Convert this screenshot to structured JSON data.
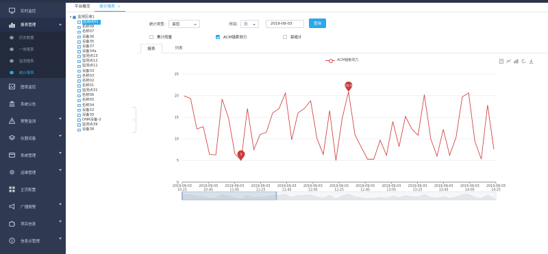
{
  "sidebar": {
    "items": [
      {
        "label": "实时监控",
        "icon": "monitor-icon",
        "arrow": false
      },
      {
        "label": "报表管理",
        "icon": "chart-bar-icon",
        "arrow": "up",
        "active": true
      },
      {
        "label": "图表监控",
        "icon": "picture-icon",
        "arrow": false
      },
      {
        "label": "系统公告",
        "icon": "bank-icon",
        "arrow": false
      },
      {
        "label": "预警监测",
        "icon": "warning-icon",
        "arrow": "down"
      },
      {
        "label": "仪器设备",
        "icon": "layers-icon",
        "arrow": "down"
      },
      {
        "label": "系统管理",
        "icon": "card-icon",
        "arrow": "down"
      },
      {
        "label": "运维管理",
        "icon": "gear-icon",
        "arrow": "down"
      },
      {
        "label": "主页配置",
        "icon": "grid-icon",
        "arrow": false
      },
      {
        "label": "广播报警",
        "icon": "megaphone-icon",
        "arrow": "down"
      },
      {
        "label": "项目信息",
        "icon": "puzzle-icon",
        "arrow": "down"
      },
      {
        "label": "信息点管理",
        "icon": "info-icon",
        "arrow": "down"
      }
    ],
    "submenu": [
      {
        "label": "历史数据",
        "active": false
      },
      {
        "label": "一体报表",
        "active": false
      },
      {
        "label": "监测报表",
        "active": false
      },
      {
        "label": "统计报表",
        "active": true
      }
    ]
  },
  "tabs": [
    {
      "label": "平台概况",
      "active": false
    },
    {
      "label": "统计报表",
      "active": true,
      "close": "×"
    }
  ],
  "tree": {
    "root": "监测区域1",
    "children": [
      "监测点01",
      "名称08",
      "名称07",
      "设备36",
      "设备35",
      "设备37",
      "设备34a",
      "监测点13",
      "监测点12",
      "监测点11",
      "设备33",
      "名称03",
      "名称02",
      "名称01",
      "监测点31",
      "名称06",
      "名称05",
      "名称04",
      "设备32",
      "设备30",
      "DNR设备-2",
      "监测点39",
      "设备38"
    ],
    "selected_index": 0
  },
  "form": {
    "stat_type_label": "统计类型:",
    "stat_type_value": "最值",
    "time_label": "时间:",
    "time_unit": "日",
    "date_value": "2019-09-03",
    "query_button": "查询"
  },
  "checkboxes": [
    {
      "label": "累计雨量",
      "checked": false
    },
    {
      "label": "ACM锚索测力",
      "checked": true
    },
    {
      "label": "裂缝计",
      "checked": false
    }
  ],
  "view_tabs": [
    {
      "label": "报表",
      "active": true
    },
    {
      "label": "列表",
      "active": false
    }
  ],
  "toolbox_icons": [
    "data-view-icon",
    "line-chart-icon",
    "bar-chart-icon",
    "restore-icon",
    "save-image-icon"
  ],
  "chart_data": {
    "type": "line",
    "series": [
      {
        "name": "ACM锚索测力",
        "color": "#d34545",
        "values": [
          19.9,
          19.3,
          12.3,
          12.8,
          6.4,
          6.3,
          19.2,
          14.8,
          6.6,
          5.0,
          17.0,
          7.5,
          11.0,
          11.5,
          16.0,
          17.0,
          20.6,
          9.8,
          16.0,
          17.0,
          18.8,
          10.1,
          6.4,
          16.5,
          5.0,
          14.8,
          20.9,
          11.0,
          8.1,
          5.3,
          5.3,
          9.7,
          6.2,
          14.0,
          8.2,
          15.2,
          12.3,
          10.8,
          20.2,
          10.0,
          6.0,
          12.2,
          6.2,
          10.3,
          19.7,
          20.6,
          9.4,
          5.3,
          17.8,
          7.6
        ]
      }
    ],
    "markers": [
      {
        "label": "20.9",
        "index": 26
      },
      {
        "label": "5",
        "index": 9
      }
    ],
    "ylim": [
      0,
      25
    ],
    "y_ticks": [
      "0",
      "5",
      "10",
      "15",
      "20",
      "25"
    ],
    "x_ticks": [
      [
        "2019-09-03",
        "10:25"
      ],
      [
        "2019-09-03",
        "10:45"
      ],
      [
        "2019-09-03",
        "11:05"
      ],
      [
        "2019-09-03",
        "11:25"
      ],
      [
        "2019-09-03",
        "11:45"
      ],
      [
        "2019-09-03",
        "12:05"
      ],
      [
        "2019-09-03",
        "12:25"
      ],
      [
        "2019-09-03",
        "12:45"
      ],
      [
        "2019-09-03",
        "13:05"
      ],
      [
        "2019-09-03",
        "13:25"
      ],
      [
        "2019-09-03",
        "13:45"
      ],
      [
        "2019-09-03",
        "14:05"
      ],
      [
        "2019-09-03",
        "14:25"
      ]
    ],
    "grid": true,
    "legend": "top-center",
    "datazoom": {
      "start": 0,
      "end": 0.3
    }
  }
}
